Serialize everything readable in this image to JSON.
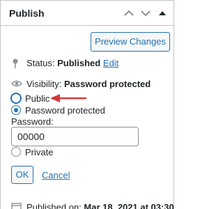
{
  "header": {
    "title": "Publish",
    "collapse_up_icon": "chevron-up-icon",
    "collapse_down_icon": "chevron-down-icon",
    "toggle_icon": "triangle-up-icon"
  },
  "actions": {
    "preview_label": "Preview Changes"
  },
  "status": {
    "label": "Status:",
    "value": "Published",
    "edit_link": "Edit"
  },
  "visibility": {
    "label": "Visibility:",
    "value": "Password protected",
    "options": [
      {
        "label": "Public",
        "checked": false
      },
      {
        "label": "Password protected",
        "checked": true
      },
      {
        "label": "Private",
        "checked": false
      }
    ],
    "password_label": "Password:",
    "password_value": "00000",
    "ok_label": "OK",
    "cancel_label": "Cancel"
  },
  "published": {
    "label": "Published on:",
    "value": "Mar 18, 2021 at 03:30"
  },
  "colors": {
    "accent": "#2271b1",
    "annotation_arrow": "#d63638"
  }
}
